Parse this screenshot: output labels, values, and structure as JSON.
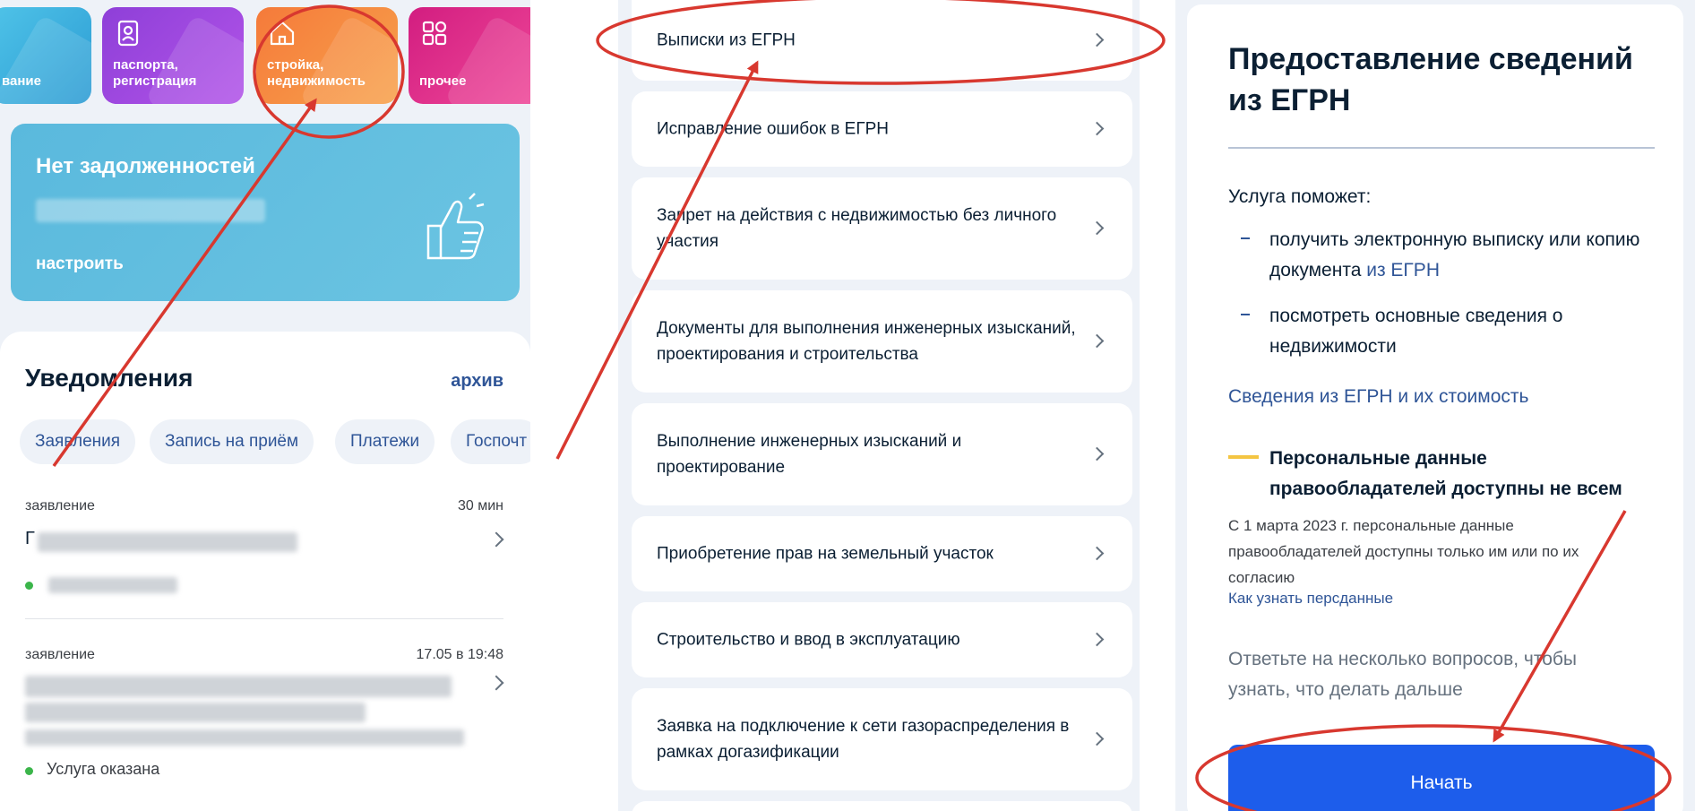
{
  "colors": {
    "annotation_red": "#d8382f",
    "brand_blue": "#1d5deb",
    "link_blue": "#2f5597",
    "status_green": "#3bb54a",
    "warning_yellow": "#f4c542"
  },
  "left_panel": {
    "category_tiles": [
      {
        "label": "вание",
        "icon": "partial-tile"
      },
      {
        "label": "паспорта,\nрегистрация",
        "icon": "person-card-icon"
      },
      {
        "label": "стройка,\nнедвижимость",
        "icon": "house-icon"
      },
      {
        "label": "прочее",
        "icon": "grid-icon"
      }
    ],
    "debt_card": {
      "title": "Нет задолженностей",
      "setup_label": "настроить",
      "icon": "thumbs-up-icon"
    },
    "notifications": {
      "title": "Уведомления",
      "archive_label": "архив",
      "filter_chips": [
        "Заявления",
        "Запись на приём",
        "Платежи",
        "Госпочт"
      ],
      "items": [
        {
          "type": "заявление",
          "time": "30 мин",
          "title_visible_start": "Г",
          "status": ""
        },
        {
          "type": "заявление",
          "time": "17.05 в 19:48",
          "status": "Услуга оказана"
        }
      ]
    }
  },
  "middle_panel": {
    "services": [
      {
        "label": "Выписки из ЕГРН"
      },
      {
        "label": "Исправление ошибок в ЕГРН"
      },
      {
        "label": "Запрет на действия с недвижимостью без личного участия"
      },
      {
        "label": "Документы для выполнения инженерных изысканий, проектирования и строительства"
      },
      {
        "label": "Выполнение инженерных изысканий и проектирование"
      },
      {
        "label": "Приобретение прав на земельный участок"
      },
      {
        "label": "Строительство и ввод в эксплуатацию"
      },
      {
        "label": "Заявка на подключение к сети газораспределения в рамках догазификации"
      }
    ]
  },
  "right_panel": {
    "title": "Предоставление сведений из ЕГРН",
    "intro": "Услуга поможет:",
    "bullets": [
      {
        "text": "получить электронную выписку или копию документа ",
        "link": "из ЕГРН"
      },
      {
        "text": "посмотреть основные сведения о недвижимости",
        "link": ""
      }
    ],
    "cost_link": "Сведения из ЕГРН и их стоимость",
    "warning": {
      "title": "Персональные данные правообладателей доступны не всем",
      "text": "С 1 марта 2023 г. персональные данные правообладателей доступны только им или по их согласию",
      "link": "Как узнать персданные"
    },
    "answer_text": "Ответьте на несколько вопросов, чтобы узнать, что делать дальше",
    "start_button": "Начать"
  }
}
